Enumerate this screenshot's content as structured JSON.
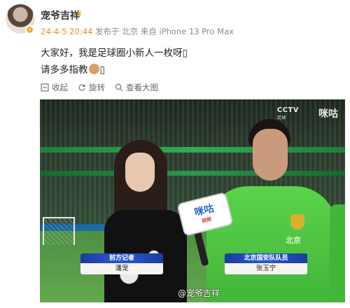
{
  "author": {
    "name": "宠爷吉祥",
    "verified_badge": "v",
    "crown_icon": "crown-icon"
  },
  "meta": {
    "time": "24-4-5 20:44",
    "source": "发布于 北京 来自 iPhone 13 Pro Max"
  },
  "post": {
    "line1": "大家好，我是足球圈小新人一枚呀",
    "line2": "请多多指教",
    "emoji": "dog-emoji"
  },
  "actions": {
    "collapse": "收起",
    "rotate": "旋转",
    "view_large": "查看大图"
  },
  "video": {
    "broadcaster_logo": "CCTV",
    "broadcaster_sub": "足球",
    "app_logo": "咪咕",
    "mic_brand": "咪咕",
    "mic_sub": "视频",
    "caption_left_title": "前方记者",
    "caption_left_name": "潘宠",
    "caption_right_title": "北京国安队队员",
    "caption_right_name": "张玉宁",
    "jersey_text": "北京",
    "watermark": "@宠爷吉祥"
  },
  "colors": {
    "time_orange": "#f08a24",
    "accent_gold": "#f5a623",
    "caption_blue": "#2a58d8"
  }
}
